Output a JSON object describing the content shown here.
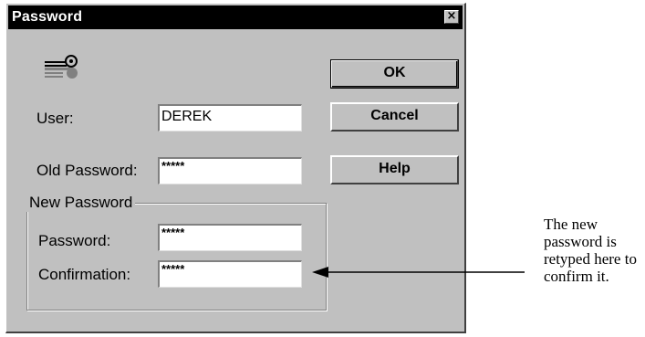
{
  "dialog": {
    "title": "Password",
    "close_glyph": "×",
    "icon": "key-icon"
  },
  "fields": {
    "user_label": "User:",
    "user_value": "DEREK",
    "old_password_label": "Old Password:",
    "old_password_value": "*****"
  },
  "new_password_group": {
    "title": "New Password",
    "password_label": "Password:",
    "password_value": "*****",
    "confirmation_label": "Confirmation:",
    "confirmation_value": "*****"
  },
  "buttons": {
    "ok": "OK",
    "cancel": "Cancel",
    "help": "Help"
  },
  "annotation": {
    "text": "The new password is retyped here to confirm it."
  }
}
